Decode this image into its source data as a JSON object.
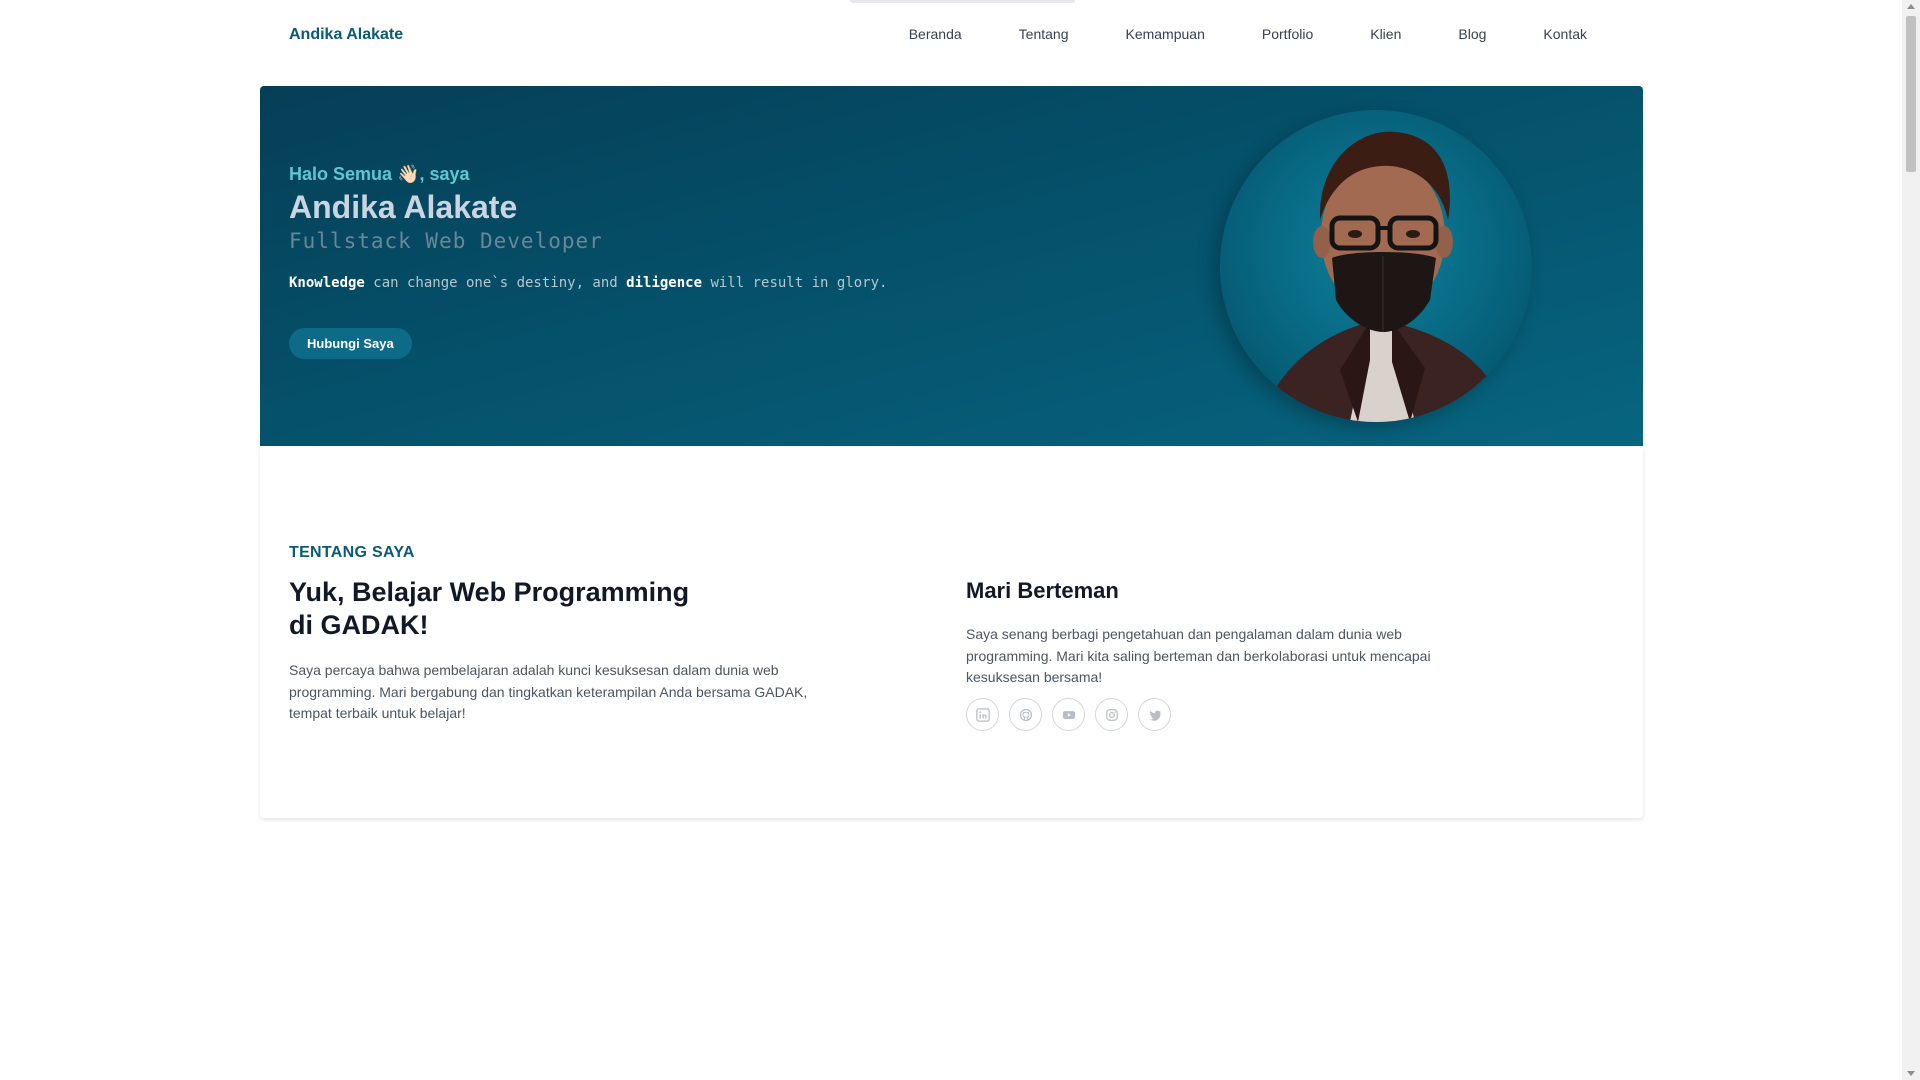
{
  "nav": {
    "brand": "Andika Alakate",
    "items": [
      {
        "label": "Beranda"
      },
      {
        "label": "Tentang"
      },
      {
        "label": "Kemampuan"
      },
      {
        "label": "Portfolio"
      },
      {
        "label": "Klien"
      },
      {
        "label": "Blog"
      },
      {
        "label": "Kontak"
      }
    ]
  },
  "hero": {
    "greeting": "Halo Semua 👋🏻, saya",
    "name": "Andika Alakate",
    "role": "Fullstack Web Developer",
    "quote_word1": "Knowledge",
    "quote_mid": " can change one`s destiny, and ",
    "quote_word2": "diligence",
    "quote_end": " will result in glory.",
    "button": "Hubungi Saya",
    "avatar_icon": "portrait-photo"
  },
  "about": {
    "eyebrow": "TENTANG SAYA",
    "title": "Yuk, Belajar Web Programming di GADAK!",
    "text": "Saya percaya bahwa pembelajaran adalah kunci kesuksesan dalam dunia web programming. Mari bergabung dan tingkatkan keterampilan Anda bersama GADAK, tempat terbaik untuk belajar!"
  },
  "social": {
    "title": "Mari Berteman",
    "text": "Saya senang berbagi pengetahuan dan pengalaman dalam dunia web programming. Mari kita saling berteman dan berkolaborasi untuk mencapai kesuksesan bersama!",
    "icons": [
      "linkedin-icon",
      "github-icon",
      "youtube-icon",
      "instagram-icon",
      "twitter-icon"
    ]
  },
  "colors": {
    "brand": "#0b5a73",
    "hero_bg_dark": "#053f56",
    "hero_bg_light": "#076580",
    "accent": "#5ec7cf",
    "button": "#0d6b87"
  }
}
